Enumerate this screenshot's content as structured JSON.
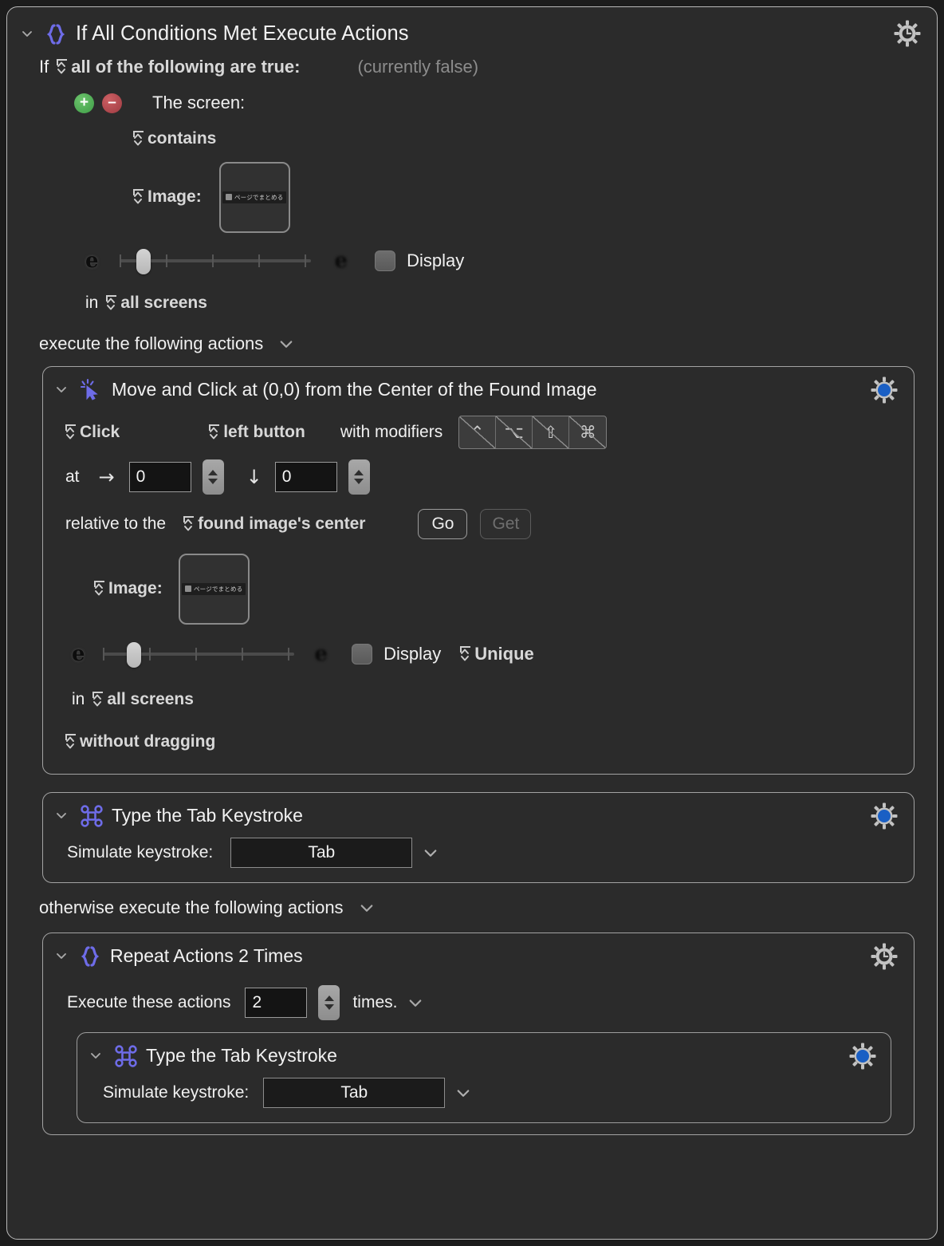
{
  "window": {
    "root_title": "If All Conditions Met Execute Actions",
    "root_icon": "braces-icon",
    "gear_clock_icon": "gear-clock-icon"
  },
  "condition": {
    "if_label": "If",
    "operator": "all of the following are true:",
    "status": "(currently false)",
    "add_icon": "plus-circle-icon",
    "remove_icon": "minus-circle-icon",
    "source_label": "The screen:",
    "comparison": "contains",
    "image_label": "Image:",
    "thumbnail_text": "ページでまとめる",
    "fuzz_low_icon": "sharp-e-icon",
    "fuzz_high_icon": "blurry-e-icon",
    "display_label": "Display",
    "scope_prefix": "in",
    "scope": "all screens"
  },
  "then_branch": {
    "label": "execute the following actions",
    "actions": [
      {
        "title": "Move and Click at (0,0) from the Center of the Found Image",
        "icon": "click-cursor-icon",
        "gear_icon": "gear-blue-icon",
        "click_action": "Click",
        "button": "left button",
        "modifiers_label": "with modifiers",
        "modifiers": [
          {
            "name": "control-modifier",
            "glyph": "⌃"
          },
          {
            "name": "option-modifier",
            "glyph": "⌥"
          },
          {
            "name": "shift-modifier",
            "glyph": "⇧"
          },
          {
            "name": "command-modifier",
            "glyph": "⌘"
          }
        ],
        "at_label": "at",
        "x_arrow": "→",
        "x_value": "0",
        "y_arrow": "↓",
        "y_value": "0",
        "relative_label": "relative to the",
        "relative_to": "found image's center",
        "go_label": "Go",
        "get_label": "Get",
        "image_label": "Image:",
        "thumbnail_text": "ページでまとめる",
        "display_label": "Display",
        "unique_label": "Unique",
        "scope_prefix": "in",
        "scope": "all screens",
        "drag_mode": "without dragging"
      },
      {
        "title": "Type the Tab Keystroke",
        "icon": "command-key-icon",
        "gear_icon": "gear-blue-icon",
        "keystroke_label": "Simulate keystroke:",
        "keystroke_value": "Tab"
      }
    ]
  },
  "else_branch": {
    "label": "otherwise execute the following actions",
    "actions": [
      {
        "title": "Repeat Actions 2 Times",
        "icon": "braces-icon",
        "gear_icon": "gear-clock-icon",
        "execute_label": "Execute these actions",
        "times_value": "2",
        "times_suffix": "times.",
        "child": {
          "title": "Type the Tab Keystroke",
          "icon": "command-key-icon",
          "gear_icon": "gear-blue-icon",
          "keystroke_label": "Simulate keystroke:",
          "keystroke_value": "Tab"
        }
      }
    ]
  },
  "colors": {
    "background": "#2b2b2b",
    "accent_purple": "#6e6ce8",
    "accent_blue": "#1a5fc4",
    "border": "#b9b9b9"
  }
}
